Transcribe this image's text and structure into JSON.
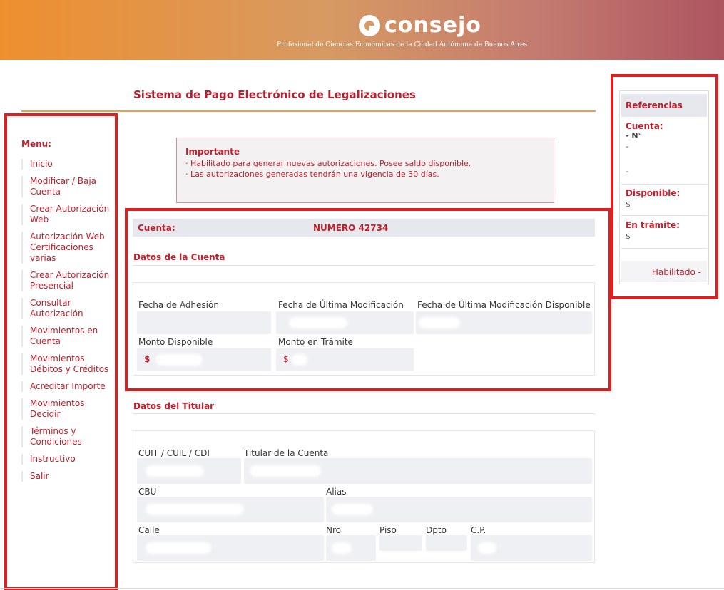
{
  "header": {
    "logo_word": "consejo",
    "subtitle": "Profesional de Ciencias Económicas de la Ciudad Autónoma de Buenos Aires"
  },
  "page_title": "Sistema de Pago Electrónico de Legalizaciones",
  "menu": {
    "title": "Menu:",
    "items": [
      "Inicio",
      "Modificar / Baja Cuenta",
      "Crear Autorización Web",
      "Autorización Web Certificaciones varias",
      "Crear Autorización Presencial",
      "Consultar Autorización",
      "Movimientos en Cuenta",
      "Movimientos Débitos y Créditos",
      "Acreditar Importe",
      "Movimientos Decidir",
      "Términos y Condiciones",
      "Instructivo",
      "Salir"
    ]
  },
  "alert": {
    "title": "Importante",
    "lines": [
      "· Habilitado para generar nuevas autorizaciones. Posee saldo disponible.",
      "· Las autorizaciones generadas tendrán una vigencia de 30 días."
    ]
  },
  "cuenta": {
    "label": "Cuenta:",
    "number": "NUMERO  42734"
  },
  "datos_cuenta": {
    "title": "Datos de la Cuenta",
    "fecha_adhesion": "Fecha de Adhesión",
    "fecha_ultima_mod": "Fecha de Última Modificación",
    "fecha_ultima_mod_disp": "Fecha de Última Modificación Disponible",
    "monto_disponible": "Monto Disponible",
    "monto_disponible_value": "$",
    "monto_tramite": "Monto en Trámite",
    "monto_tramite_value": "$"
  },
  "datos_titular": {
    "title": "Datos del Titular",
    "cuit": "CUIT / CUIL / CDI",
    "titular": "Titular de la Cuenta",
    "cbu": "CBU",
    "alias": "Alias",
    "calle": "Calle",
    "nro": "Nro",
    "piso": "Piso",
    "dpto": "Dpto",
    "cp": "C.P."
  },
  "referencias": {
    "title": "Referencias",
    "cuenta_label": "Cuenta:",
    "cuenta_line1": "- N°",
    "cuenta_line2": "-",
    "cuenta_line3": "-",
    "disponible_label": "Disponible:",
    "disponible_value": "$",
    "tramite_label": "En trámite:",
    "tramite_value": "$",
    "status": "Habilitado -"
  },
  "colors": {
    "accent": "#c0202c",
    "highlight_frame": "#dd1f1f"
  }
}
